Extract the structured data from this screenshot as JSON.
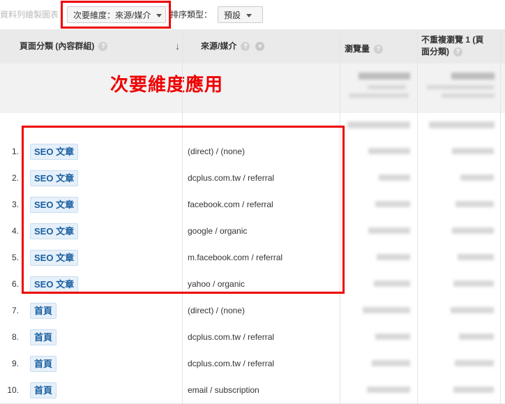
{
  "toolbar": {
    "chart_rows_label": "資料列繪製圖表",
    "secondary_dimension": "次要維度：來源/媒介",
    "sort_type_label": "排序類型：",
    "sort_default": "預設"
  },
  "annotation": "次要維度應用",
  "columns": {
    "page_group": "頁面分類 (內容群組)",
    "source_medium": "來源/媒介",
    "pageviews": "瀏覽量",
    "unique_pageviews_line1": "不重複瀏覽 1 (頁",
    "unique_pageviews_line2": "面分類)"
  },
  "rows": [
    {
      "num": "1.",
      "group": "SEO 文章",
      "source": "(direct) / (none)"
    },
    {
      "num": "2.",
      "group": "SEO 文章",
      "source": "dcplus.com.tw / referral"
    },
    {
      "num": "3.",
      "group": "SEO 文章",
      "source": "facebook.com / referral"
    },
    {
      "num": "4.",
      "group": "SEO 文章",
      "source": "google / organic"
    },
    {
      "num": "5.",
      "group": "SEO 文章",
      "source": "m.facebook.com / referral"
    },
    {
      "num": "6.",
      "group": "SEO 文章",
      "source": "yahoo / organic"
    },
    {
      "num": "7.",
      "group": "首頁",
      "source": "(direct) / (none)"
    },
    {
      "num": "8.",
      "group": "首頁",
      "source": "dcplus.com.tw / referral"
    },
    {
      "num": "9.",
      "group": "首頁",
      "source": "dcplus.com.tw / referral"
    },
    {
      "num": "10.",
      "group": "首頁",
      "source": "email / subscription"
    }
  ],
  "colors": {
    "highlight": "#ee0000",
    "tag_text": "#1a5fa0",
    "tag_bg": "#e6f0fa"
  },
  "icons": {
    "help": "help-icon",
    "remove": "close-icon",
    "sort": "sort-down-arrow-icon"
  }
}
